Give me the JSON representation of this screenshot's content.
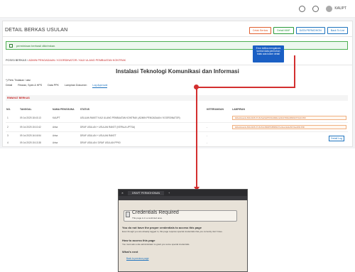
{
  "topbar": {
    "user": "KAUPT"
  },
  "page": {
    "title": "DETAIL BERKAS USULAN",
    "buttons": [
      "Cetak Berkas",
      "Detail MMF",
      "DATA PERMOHON",
      "Back To List"
    ]
  },
  "alert": "permintaan berhasil dikirimkan.",
  "tooltip": "Error ketika mengakses tombol data permohon tidak ada kolom detail",
  "breadcrumb": {
    "prefix": "POSISI BERKAS /",
    "path": "ADMIN PENGADAAN / KOORDINATOR / KAJI ULANG PEMBUATAN KONTRAK"
  },
  "heading": "Instalasi Teknologi Komunikasi dan Informasi",
  "required_note": "*) Perlu Tindakan / aksi",
  "tabs": [
    "Detail",
    "Rincian, Spek & HPS",
    "Data PPK",
    "Lampiran Dokumen",
    "Log Approval"
  ],
  "section": "RIWAYAT BERKAS",
  "table": {
    "headers": [
      "NO.",
      "TANGGAL",
      "NAMA PENGGUNA",
      "STATUS",
      "KETERANGAN",
      "LAMPIRAN"
    ],
    "rows": [
      {
        "no": "1",
        "date": "09 Jul 2025 18:43:13",
        "user": "KAUPT",
        "status": "USULAN RAKET KAJI ULANG PEMBUATAN KONTRAK (ADMIN PENGADAAN / KOORDINATOR)",
        "ket": "",
        "doc": "dkbudnsuenk-690-2025-07-09-5a23e87f1f9cdb8dcce09c27966e38993d77fe40.PDF"
      },
      {
        "no": "2",
        "date": "09 Jul 2025 15:10:42",
        "user": "Arisa",
        "status": "DRAF USULAN + USULAN RAKET (KEPALA UPTSA)",
        "ket": "-",
        "doc": "dkbudnsuenk-690-2025-07-09-81c4f9b8f7b8f866b37e1bee12a4e5b7dee4f93.PDF"
      },
      {
        "no": "3",
        "date": "09 Jul 2025 16:16:54",
        "user": "Arisa",
        "status": "DRAF USULAN + USULAN RAKET",
        "ket": "-",
        "doc": ""
      },
      {
        "no": "4",
        "date": "09 Jul 2025 15:13:38",
        "user": "Arisa",
        "status": "DRAF USULAN / DRAF USULAN PPK0",
        "ket": "-",
        "doc": ""
      }
    ]
  },
  "detail_log": "Detail Log",
  "popup": {
    "tab": "DRAFT PERMOHONAN",
    "title": "Credentials Required",
    "subtitle": "This page is in a restricted area.",
    "h1": "You do not have the proper credentials to access this page",
    "p1": "Even though you are already logged in, this page requires special credentials that you currently don't have.",
    "h2": "How to access this page",
    "p2": "You must ask a site administrator to grant you some special credentials.",
    "h3": "What's next",
    "back": "Back to previous page"
  }
}
